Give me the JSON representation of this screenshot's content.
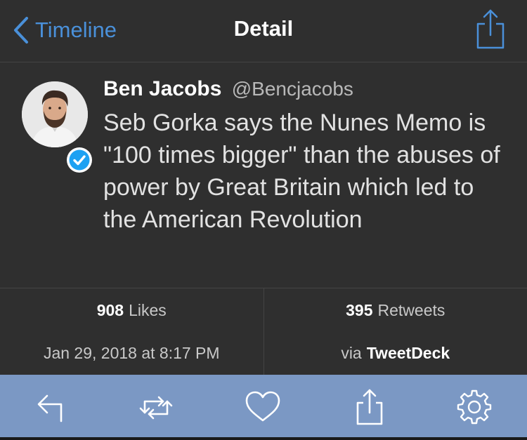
{
  "nav": {
    "back_label": "Timeline",
    "title": "Detail",
    "share_icon": "share-icon"
  },
  "tweet": {
    "author_name": "Ben Jacobs",
    "author_handle": "@Bencjacobs",
    "verified": true,
    "text": "Seb Gorka says the Nunes Memo is \"100 times bigger\" than the abuses of power by Great Britain which led to the American Revolution"
  },
  "stats": {
    "likes_count": "908",
    "likes_label": "Likes",
    "retweets_count": "395",
    "retweets_label": "Retweets"
  },
  "meta": {
    "timestamp": "Jan 29, 2018 at 8:17 PM",
    "via_prefix": "via",
    "via_app": "TweetDeck"
  },
  "toolbar": {
    "icons": [
      "reply-icon",
      "retweet-icon",
      "like-icon",
      "share-icon",
      "settings-icon"
    ]
  },
  "colors": {
    "accent": "#4a90d9",
    "toolbar_bg": "#7b98c4",
    "background": "#2f2f2f",
    "verified_badge": "#1da1f2"
  }
}
